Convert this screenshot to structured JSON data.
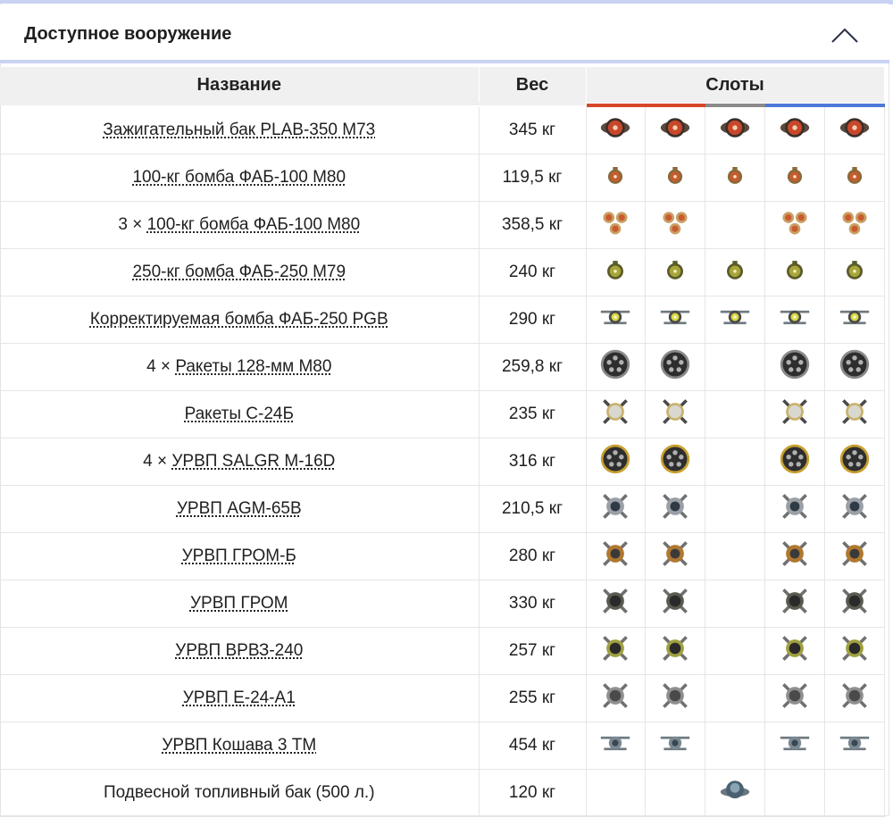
{
  "panel": {
    "title": "Доступное вооружение"
  },
  "table": {
    "headers": {
      "name": "Название",
      "weight": "Вес",
      "slots": "Слоты"
    },
    "slot_colors": [
      "#d8462a",
      "#d8462a",
      "#8a8a8a",
      "#4d78d8",
      "#4d78d8"
    ],
    "rows": [
      {
        "prefix": "",
        "name": "Зажигательный бак PLAB-350 M73",
        "weight": "345 кг",
        "icon": "incendiary-tank-icon",
        "slots": [
          1,
          1,
          1,
          1,
          1
        ]
      },
      {
        "prefix": "",
        "name": "100-кг бомба ФАБ-100 М80",
        "weight": "119,5 кг",
        "icon": "small-bomb-icon",
        "slots": [
          1,
          1,
          1,
          1,
          1
        ]
      },
      {
        "prefix": "3 × ",
        "name": "100-кг бомба ФАБ-100 М80",
        "weight": "358,5 кг",
        "icon": "triple-bomb-icon",
        "slots": [
          1,
          1,
          0,
          1,
          1
        ]
      },
      {
        "prefix": "",
        "name": "250-кг бомба ФАБ-250 М79",
        "weight": "240 кг",
        "icon": "olive-bomb-icon",
        "slots": [
          1,
          1,
          1,
          1,
          1
        ]
      },
      {
        "prefix": "",
        "name": "Корректируемая бомба ФАБ-250 PGB",
        "weight": "290 кг",
        "icon": "guided-bomb-icon",
        "slots": [
          1,
          1,
          1,
          1,
          1
        ]
      },
      {
        "prefix": "4 × ",
        "name": "Ракеты 128-мм М80",
        "weight": "259,8 кг",
        "icon": "rocket-pod-icon",
        "slots": [
          1,
          1,
          0,
          1,
          1
        ]
      },
      {
        "prefix": "",
        "name": "Ракеты С-24Б",
        "weight": "235 кг",
        "icon": "rocket-icon",
        "slots": [
          1,
          1,
          0,
          1,
          1
        ]
      },
      {
        "prefix": "4 × ",
        "name": "УРВП SALGR M-16D",
        "weight": "316 кг",
        "icon": "gold-rocket-pod-icon",
        "slots": [
          1,
          1,
          0,
          1,
          1
        ]
      },
      {
        "prefix": "",
        "name": "УРВП AGM-65B",
        "weight": "210,5 кг",
        "icon": "missile-icon",
        "slots": [
          1,
          1,
          0,
          1,
          1
        ]
      },
      {
        "prefix": "",
        "name": "УРВП ГРОМ-Б",
        "weight": "280 кг",
        "icon": "bronze-missile-icon",
        "slots": [
          1,
          1,
          0,
          1,
          1
        ]
      },
      {
        "prefix": "",
        "name": "УРВП ГРОМ",
        "weight": "330 кг",
        "icon": "dark-missile-icon",
        "slots": [
          1,
          1,
          0,
          1,
          1
        ]
      },
      {
        "prefix": "",
        "name": "УРВП ВРВЗ-240",
        "weight": "257 кг",
        "icon": "olive-missile-icon",
        "slots": [
          1,
          1,
          0,
          1,
          1
        ]
      },
      {
        "prefix": "",
        "name": "УРВП Е-24-А1",
        "weight": "255 кг",
        "icon": "grey-missile-icon",
        "slots": [
          1,
          1,
          0,
          1,
          1
        ]
      },
      {
        "prefix": "",
        "name": "УРВП Кошава 3 ТМ",
        "weight": "454 кг",
        "icon": "winged-missile-icon",
        "slots": [
          1,
          1,
          0,
          1,
          1
        ]
      },
      {
        "prefix": "",
        "name": "Подвесной топливный бак (500 л.)",
        "weight": "120 кг",
        "icon": "fuel-tank-icon",
        "slots": [
          0,
          0,
          1,
          0,
          0
        ],
        "plain": true
      }
    ]
  }
}
